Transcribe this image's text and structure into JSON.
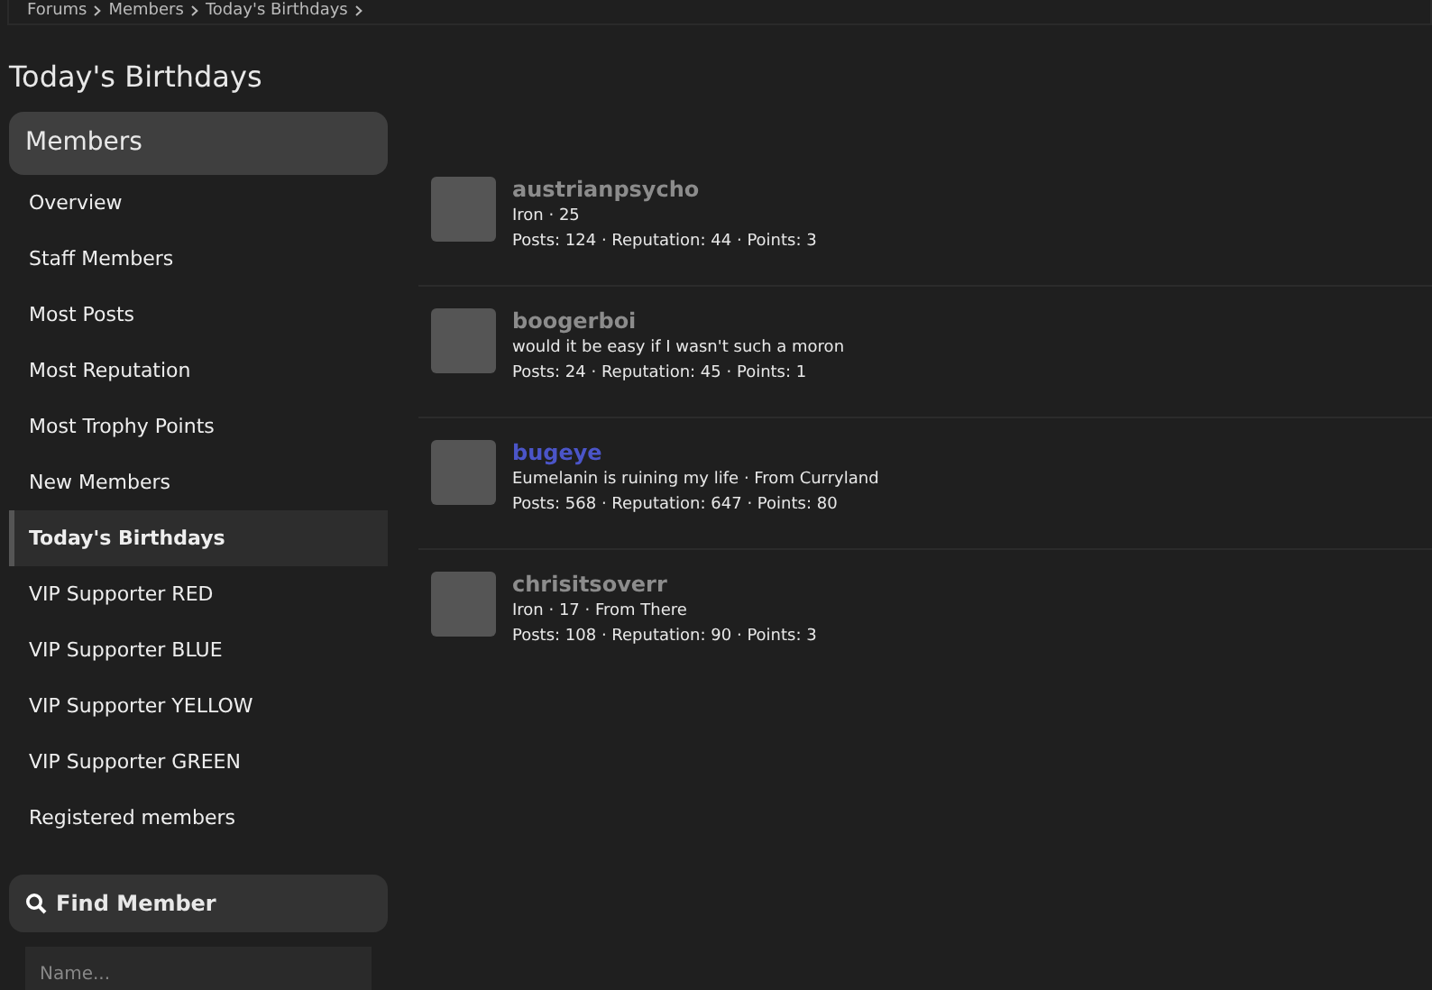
{
  "breadcrumb": [
    "Forums",
    "Members",
    "Today's Birthdays"
  ],
  "page_title": "Today's Birthdays",
  "sidebar": {
    "heading": "Members",
    "items": [
      {
        "label": "Overview",
        "selected": false
      },
      {
        "label": "Staff Members",
        "selected": false
      },
      {
        "label": "Most Posts",
        "selected": false
      },
      {
        "label": "Most Reputation",
        "selected": false
      },
      {
        "label": "Most Trophy Points",
        "selected": false
      },
      {
        "label": "New Members",
        "selected": false
      },
      {
        "label": "Today's Birthdays",
        "selected": true
      },
      {
        "label": "VIP Supporter RED",
        "selected": false
      },
      {
        "label": "VIP Supporter BLUE",
        "selected": false
      },
      {
        "label": "VIP Supporter YELLOW",
        "selected": false
      },
      {
        "label": "VIP Supporter GREEN",
        "selected": false
      },
      {
        "label": "Registered members",
        "selected": false
      }
    ]
  },
  "find_member": {
    "heading": "Find Member",
    "placeholder": "Name..."
  },
  "members": [
    {
      "username": "austrianpsycho",
      "color": "#8c8c8c",
      "info": "Iron · 25",
      "stats": "Posts: 124 · Reputation: 44 · Points: 3"
    },
    {
      "username": "boogerboi",
      "color": "#8c8c8c",
      "info": "would it be easy if I wasn't such a moron",
      "stats": "Posts: 24 · Reputation: 45 · Points: 1"
    },
    {
      "username": "bugeye",
      "color": "#4b55c8",
      "info": "Eumelanin is ruining my life · From Curryland",
      "stats": "Posts: 568 · Reputation: 647 · Points: 80"
    },
    {
      "username": "chrisitsoverr",
      "color": "#8c8c8c",
      "info": "Iron · 17 · From There",
      "stats": "Posts: 108 · Reputation: 90 · Points: 3"
    }
  ]
}
